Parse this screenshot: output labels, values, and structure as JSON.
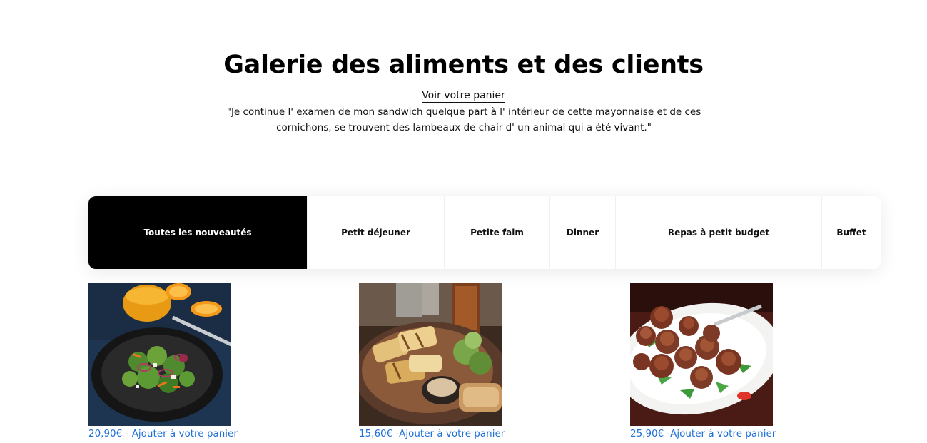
{
  "header": {
    "title": "Galerie des aliments et des clients",
    "cart_link": "Voir votre panier",
    "quote": "\"Je continue l' examen de mon sandwich quelque part à l' intérieur de cette mayonnaise et de ces cornichons, se trouvent des lambeaux de chair d' un animal qui a été vivant.\""
  },
  "tabs": [
    {
      "label": "Toutes les nouveautés",
      "active": true
    },
    {
      "label": "Petit déjeuner",
      "active": false
    },
    {
      "label": "Petite faim",
      "active": false
    },
    {
      "label": "Dinner",
      "active": false
    },
    {
      "label": "Repas à petit budget",
      "active": false
    },
    {
      "label": "Buffet",
      "active": false
    }
  ],
  "products": [
    {
      "image": "salad-photo",
      "link": "20,90€ - Ajouter à votre panier"
    },
    {
      "image": "grilled-plate-photo",
      "link": "15,60€ -Ajouter à votre panier"
    },
    {
      "image": "meatballs-photo",
      "link": "25,90€ -Ajouter à votre panier"
    }
  ],
  "colors": {
    "link": "#1e6fd9",
    "active_tab_bg": "#000000",
    "active_tab_text": "#ffffff"
  }
}
